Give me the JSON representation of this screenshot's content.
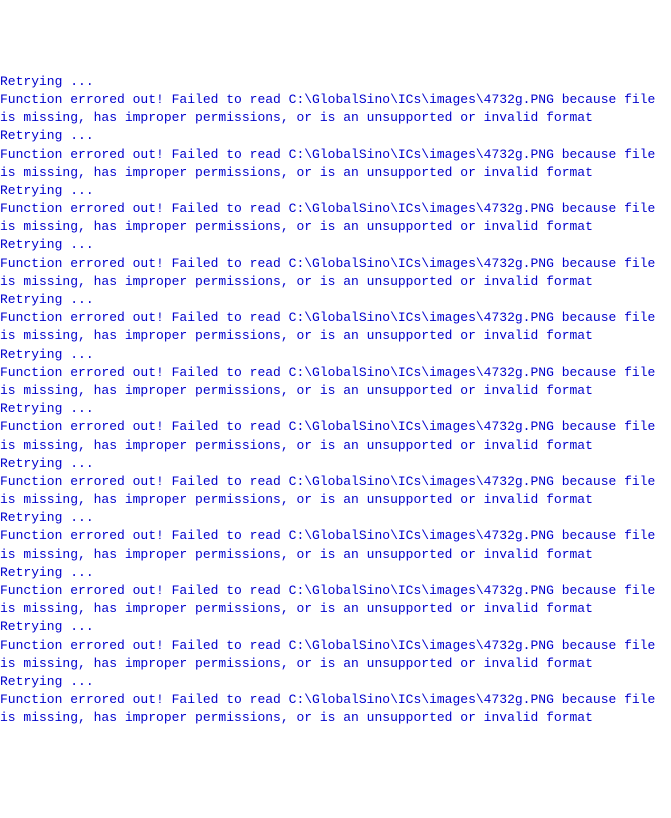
{
  "console": {
    "retry_text": "Retrying ...",
    "error_prefix": "Function errored out! Failed to read ",
    "file_path": "C:\\GlobalSino\\ICs\\images\\4732g.PNG",
    "error_reason": " because file is missing, has improper permissions, or is an unsupported or invalid format",
    "lines": [
      {
        "type": "retry"
      },
      {
        "type": "error"
      },
      {
        "type": "retry"
      },
      {
        "type": "error"
      },
      {
        "type": "retry"
      },
      {
        "type": "error"
      },
      {
        "type": "retry"
      },
      {
        "type": "error"
      },
      {
        "type": "retry"
      },
      {
        "type": "error"
      },
      {
        "type": "retry"
      },
      {
        "type": "error"
      },
      {
        "type": "retry"
      },
      {
        "type": "error"
      },
      {
        "type": "retry"
      },
      {
        "type": "error"
      },
      {
        "type": "retry"
      },
      {
        "type": "error"
      },
      {
        "type": "retry"
      },
      {
        "type": "error"
      },
      {
        "type": "retry"
      },
      {
        "type": "error"
      },
      {
        "type": "retry"
      },
      {
        "type": "error"
      }
    ]
  }
}
